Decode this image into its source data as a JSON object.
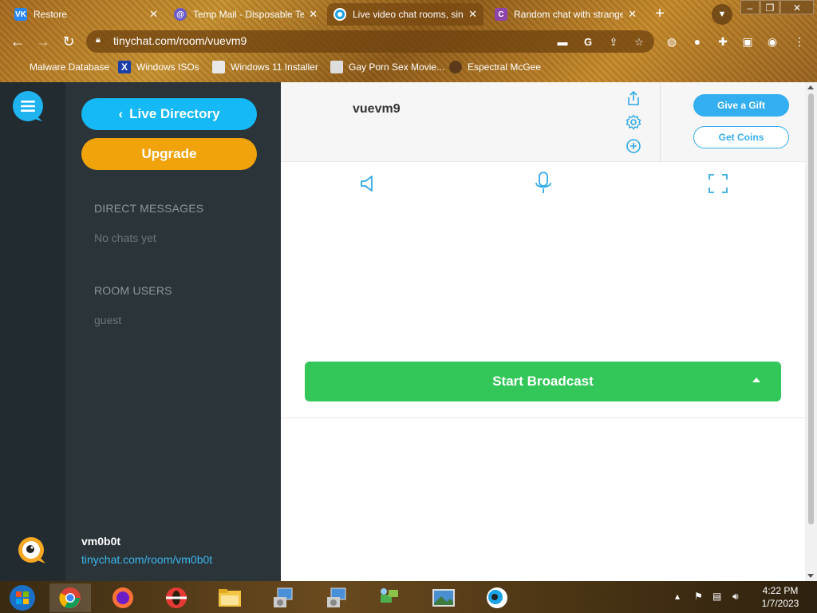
{
  "browser": {
    "tabs": [
      {
        "label": "Restore",
        "favicon": "vk-icon",
        "favicon_color": "#2787f5",
        "favicon_text": "VK",
        "active": false
      },
      {
        "label": "Temp Mail - Disposable Te",
        "favicon": "at-sign-icon",
        "favicon_color": "#6a5acd",
        "favicon_text": "@",
        "active": false
      },
      {
        "label": "Live video chat rooms, sin",
        "favicon": "tinychat-icon",
        "favicon_color": "#1aa3e8",
        "favicon_text": "",
        "active": true
      },
      {
        "label": "Random chat with strange",
        "favicon": "chatroulette-icon",
        "favicon_color": "#8e44ad",
        "favicon_text": "C",
        "active": false
      }
    ],
    "url": "tinychat.com/room/vuevm9",
    "bookmarks": [
      {
        "label": "Malware Database",
        "icon": "bookmark-icon"
      },
      {
        "label": "Windows ISOs",
        "icon": "x-logo-icon"
      },
      {
        "label": "Windows 11 Installer",
        "icon": "image-icon"
      },
      {
        "label": "Gay Porn Sex Movie...",
        "icon": "site-icon"
      },
      {
        "label": "Espectral McGee",
        "icon": "avatar-icon"
      }
    ]
  },
  "sidebar": {
    "live_directory_label": "Live Directory",
    "upgrade_label": "Upgrade",
    "direct_messages_heading": "DIRECT MESSAGES",
    "direct_messages_empty": "No chats yet",
    "room_users_heading": "ROOM USERS",
    "room_users": [
      "guest"
    ],
    "me_name": "vm0b0t",
    "me_link": "tinychat.com/room/vm0b0t"
  },
  "main": {
    "room_name": "vuevm9",
    "gift_label": "Give a Gift",
    "coins_label": "Get Coins",
    "broadcast_label": "Start Broadcast"
  },
  "taskbar": {
    "time": "4:22 PM",
    "date": "1/7/2023"
  },
  "colors": {
    "accent_blue": "#15b9f5",
    "upgrade_orange": "#f0a30a",
    "broadcast_green": "#33c759",
    "sidebar_bg": "#2b3439"
  }
}
